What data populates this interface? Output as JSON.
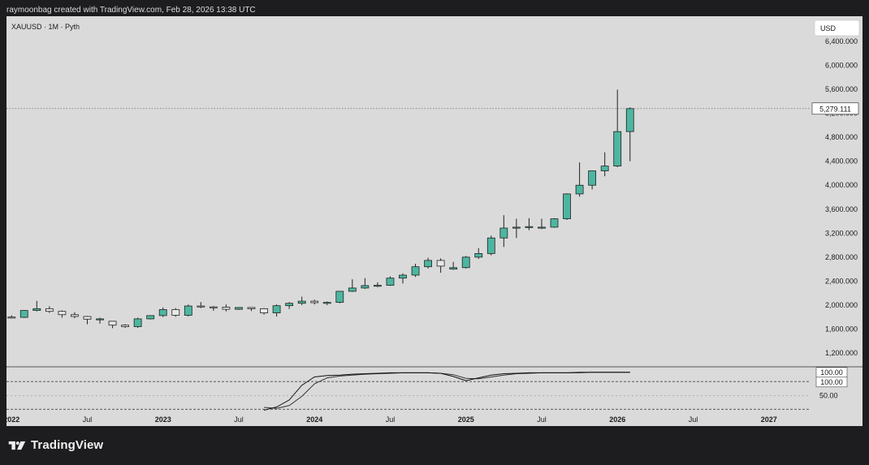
{
  "header": {
    "caption": "raymoonbag created with TradingView.com, Feb 28, 2026 13:38 UTC"
  },
  "brand": {
    "name": "TradingView",
    "logo_icon": "tradingview-logo-icon"
  },
  "chart_data": {
    "type": "candlestick",
    "symbol_label": "XAUUSD · 1M · Pyth",
    "currency_label": "USD",
    "last_price_label": "5,279.111",
    "last_price": 5279.111,
    "y_ticks": [
      "6,400.000",
      "6,000.000",
      "5,600.000",
      "5,200.000",
      "4,800.000",
      "4,400.000",
      "4,000.000",
      "3,600.000",
      "3,200.000",
      "2,800.000",
      "2,400.000",
      "2,000.000",
      "1,600.000",
      "1,200.000"
    ],
    "y_tick_values": [
      6400,
      6000,
      5600,
      5200,
      4800,
      4400,
      4000,
      3600,
      3200,
      2800,
      2400,
      2000,
      1600,
      1200
    ],
    "ylim": [
      970,
      6820
    ],
    "x_ticks": [
      "2022",
      "Jul",
      "2023",
      "Jul",
      "2024",
      "Jul",
      "2025",
      "Jul",
      "2026",
      "Jul",
      "2027"
    ],
    "x_tick_index": [
      0,
      6,
      12,
      18,
      24,
      30,
      36,
      42,
      48,
      54,
      60
    ],
    "xlim": [
      -0.4,
      63.3
    ],
    "up_color": "#4db6a0",
    "down_color": "#e8e8e8",
    "candles": [
      {
        "o": 1800,
        "h": 1830,
        "l": 1780,
        "c": 1795
      },
      {
        "o": 1795,
        "h": 1915,
        "l": 1785,
        "c": 1910
      },
      {
        "o": 1910,
        "h": 2070,
        "l": 1895,
        "c": 1940
      },
      {
        "o": 1940,
        "h": 1980,
        "l": 1870,
        "c": 1895
      },
      {
        "o": 1895,
        "h": 1910,
        "l": 1790,
        "c": 1840
      },
      {
        "o": 1840,
        "h": 1880,
        "l": 1780,
        "c": 1810
      },
      {
        "o": 1810,
        "h": 1820,
        "l": 1680,
        "c": 1765
      },
      {
        "o": 1765,
        "h": 1790,
        "l": 1690,
        "c": 1770
      },
      {
        "o": 1730,
        "h": 1735,
        "l": 1615,
        "c": 1665
      },
      {
        "o": 1665,
        "h": 1680,
        "l": 1620,
        "c": 1640
      },
      {
        "o": 1640,
        "h": 1790,
        "l": 1620,
        "c": 1770
      },
      {
        "o": 1770,
        "h": 1830,
        "l": 1760,
        "c": 1825
      },
      {
        "o": 1825,
        "h": 1960,
        "l": 1800,
        "c": 1925
      },
      {
        "o": 1925,
        "h": 1950,
        "l": 1805,
        "c": 1830
      },
      {
        "o": 1830,
        "h": 2010,
        "l": 1810,
        "c": 1985
      },
      {
        "o": 1985,
        "h": 2050,
        "l": 1950,
        "c": 1970
      },
      {
        "o": 1970,
        "h": 1985,
        "l": 1905,
        "c": 1965
      },
      {
        "o": 1965,
        "h": 2010,
        "l": 1895,
        "c": 1930
      },
      {
        "o": 1930,
        "h": 1965,
        "l": 1920,
        "c": 1960
      },
      {
        "o": 1960,
        "h": 1965,
        "l": 1900,
        "c": 1940
      },
      {
        "o": 1940,
        "h": 1950,
        "l": 1840,
        "c": 1870
      },
      {
        "o": 1870,
        "h": 2010,
        "l": 1810,
        "c": 1990
      },
      {
        "o": 1990,
        "h": 2050,
        "l": 1935,
        "c": 2030
      },
      {
        "o": 2030,
        "h": 2140,
        "l": 2000,
        "c": 2065
      },
      {
        "o": 2065,
        "h": 2090,
        "l": 2010,
        "c": 2040
      },
      {
        "o": 2040,
        "h": 2060,
        "l": 2000,
        "c": 2045
      },
      {
        "o": 2045,
        "h": 2225,
        "l": 2030,
        "c": 2230
      },
      {
        "o": 2230,
        "h": 2430,
        "l": 2220,
        "c": 2285
      },
      {
        "o": 2285,
        "h": 2450,
        "l": 2270,
        "c": 2325
      },
      {
        "o": 2325,
        "h": 2380,
        "l": 2300,
        "c": 2330
      },
      {
        "o": 2330,
        "h": 2480,
        "l": 2320,
        "c": 2450
      },
      {
        "o": 2450,
        "h": 2530,
        "l": 2360,
        "c": 2500
      },
      {
        "o": 2500,
        "h": 2690,
        "l": 2470,
        "c": 2640
      },
      {
        "o": 2640,
        "h": 2790,
        "l": 2610,
        "c": 2745
      },
      {
        "o": 2745,
        "h": 2780,
        "l": 2540,
        "c": 2650
      },
      {
        "o": 2600,
        "h": 2720,
        "l": 2590,
        "c": 2625
      },
      {
        "o": 2625,
        "h": 2820,
        "l": 2610,
        "c": 2800
      },
      {
        "o": 2800,
        "h": 2950,
        "l": 2770,
        "c": 2860
      },
      {
        "o": 2860,
        "h": 3160,
        "l": 2830,
        "c": 3120
      },
      {
        "o": 3120,
        "h": 3500,
        "l": 2970,
        "c": 3285
      },
      {
        "o": 3285,
        "h": 3440,
        "l": 3120,
        "c": 3300
      },
      {
        "o": 3300,
        "h": 3450,
        "l": 3250,
        "c": 3310
      },
      {
        "o": 3290,
        "h": 3440,
        "l": 3270,
        "c": 3300
      },
      {
        "o": 3300,
        "h": 3450,
        "l": 3290,
        "c": 3440
      },
      {
        "o": 3440,
        "h": 3865,
        "l": 3420,
        "c": 3855
      },
      {
        "o": 3855,
        "h": 4380,
        "l": 3810,
        "c": 4000
      },
      {
        "o": 4000,
        "h": 4245,
        "l": 3930,
        "c": 4240
      },
      {
        "o": 4240,
        "h": 4550,
        "l": 4150,
        "c": 4320
      },
      {
        "o": 4320,
        "h": 5595,
        "l": 4300,
        "c": 4895
      },
      {
        "o": 4895,
        "h": 5300,
        "l": 4400,
        "c": 5279
      }
    ],
    "stoch": {
      "hlines": [
        80,
        20
      ],
      "mid_label": "50.00",
      "k_label": "100.00",
      "d_label": "100.00",
      "ylim": [
        10,
        112
      ],
      "k": [
        0,
        0,
        0,
        0,
        0,
        0,
        0,
        0,
        0,
        0,
        0,
        0,
        0,
        0,
        0,
        0,
        0,
        0,
        0,
        0,
        18,
        25,
        40,
        72,
        90,
        93,
        94,
        96,
        97,
        98,
        99,
        99,
        99,
        99,
        98,
        91,
        82,
        88,
        94,
        97,
        98,
        99,
        99,
        99,
        99,
        100,
        100,
        100,
        100,
        100
      ],
      "d": [
        0,
        0,
        0,
        0,
        0,
        0,
        0,
        0,
        0,
        0,
        0,
        0,
        0,
        0,
        0,
        0,
        0,
        0,
        0,
        0,
        24,
        22,
        28,
        48,
        75,
        88,
        92,
        94,
        96,
        97,
        98,
        99,
        99,
        99,
        98,
        95,
        87,
        86,
        90,
        94,
        97,
        98,
        99,
        99,
        99,
        99,
        100,
        100,
        100,
        100
      ],
      "visible_from": 20
    }
  }
}
